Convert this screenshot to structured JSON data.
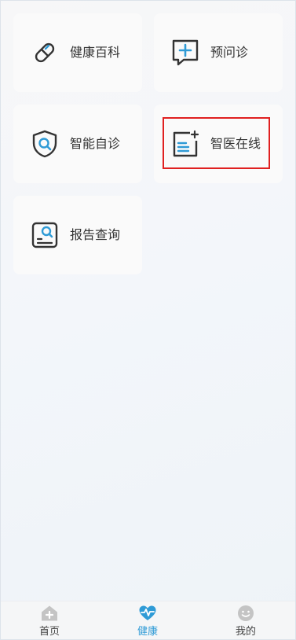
{
  "cards": [
    {
      "label": "健康百科",
      "icon": "capsule-icon"
    },
    {
      "label": "预问诊",
      "icon": "chat-plus-icon"
    },
    {
      "label": "智能自诊",
      "icon": "shield-search-icon"
    },
    {
      "label": "智医在线",
      "icon": "medical-doc-plus-icon"
    },
    {
      "label": "报告查询",
      "icon": "report-search-icon"
    }
  ],
  "tabbar": {
    "items": [
      {
        "label": "首页",
        "icon": "home-plus-icon"
      },
      {
        "label": "健康",
        "icon": "heart-pulse-icon",
        "active": true
      },
      {
        "label": "我的",
        "icon": "smiley-icon"
      }
    ],
    "active_color": "#2f9bd6",
    "inactive_color": "#c4c4c4"
  },
  "colors": {
    "icon_dark": "#333333",
    "icon_accent": "#2f9bd6",
    "highlight": "#e02020"
  }
}
